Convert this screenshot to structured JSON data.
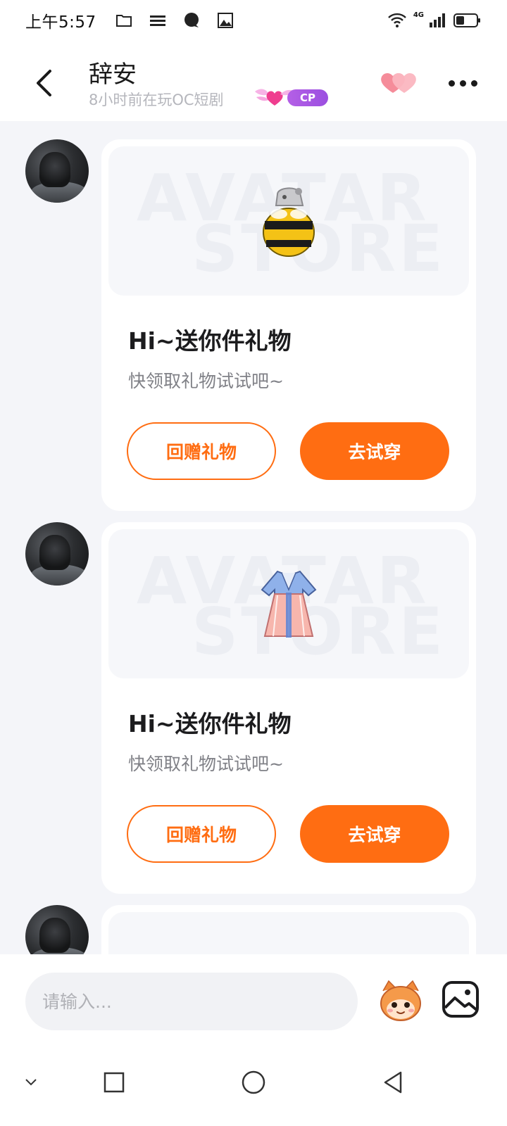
{
  "status_bar": {
    "time": "上午5:57",
    "network_label": "4G",
    "icons_left": [
      "folder-icon",
      "list-icon",
      "chat-bubble-icon",
      "image-icon"
    ],
    "icons_right": [
      "wifi-icon",
      "signal-icon",
      "battery-icon"
    ]
  },
  "header": {
    "name": "辞安",
    "status": "8小时前在玩OC短剧",
    "badge_label": "CP"
  },
  "messages": [
    {
      "title": "Hi~送你件礼物",
      "subtitle": "快领取礼物试试吧~",
      "watermark_top": "AVATAR",
      "watermark_bottom": "STORE",
      "gift": "bee-costume",
      "return_gift_label": "回赠礼物",
      "try_on_label": "去试穿"
    },
    {
      "title": "Hi~送你件礼物",
      "subtitle": "快领取礼物试试吧~",
      "watermark_top": "AVATAR",
      "watermark_bottom": "STORE",
      "gift": "hanfu-robe",
      "return_gift_label": "回赠礼物",
      "try_on_label": "去试穿"
    }
  ],
  "input": {
    "placeholder": "请输入...",
    "value": ""
  },
  "colors": {
    "accent": "#ff6d12",
    "background": "#f4f5f9",
    "card": "#ffffff",
    "badge": "#a855e6"
  }
}
